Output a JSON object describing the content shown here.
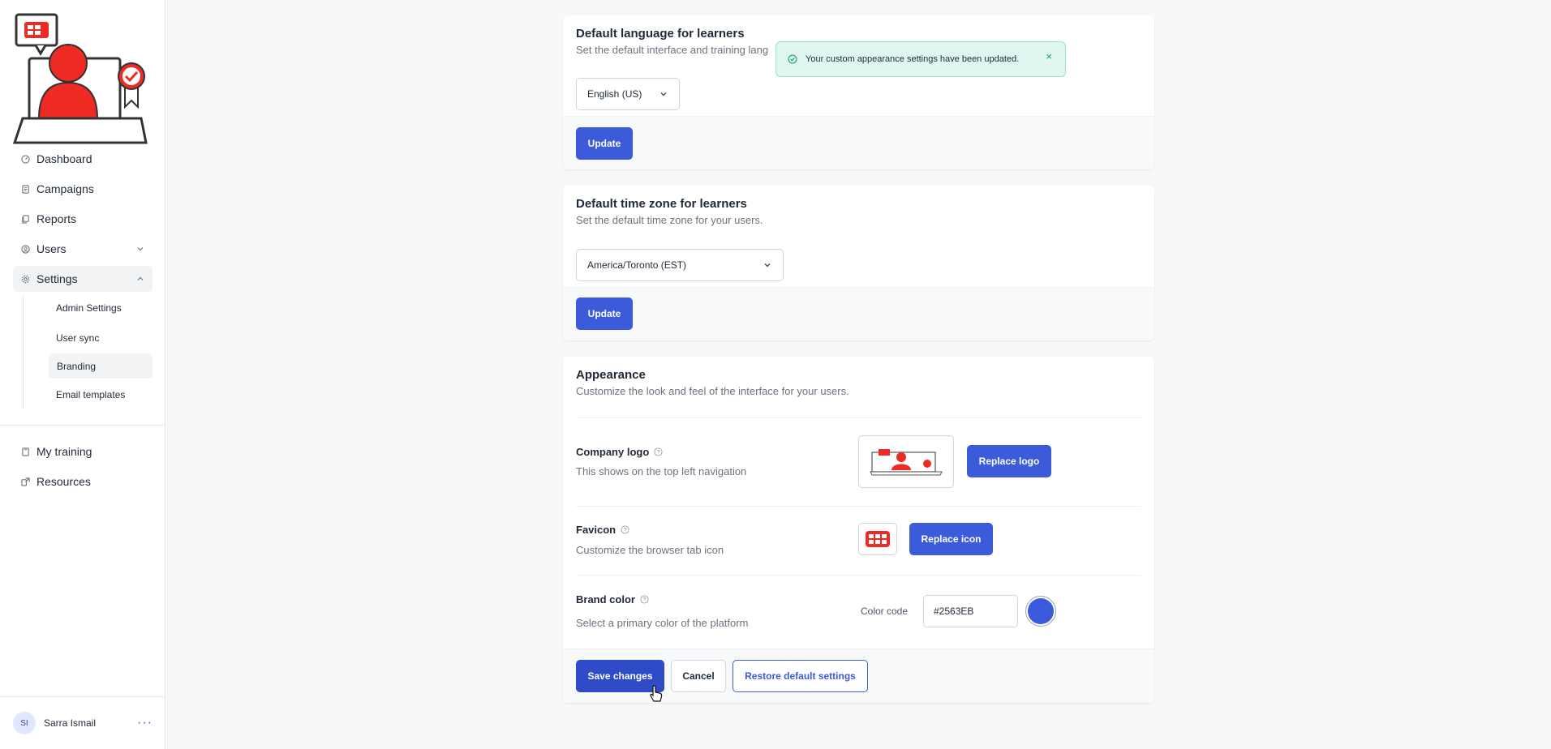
{
  "sidebar": {
    "nav": [
      {
        "label": "Dashboard",
        "icon": "gauge-icon"
      },
      {
        "label": "Campaigns",
        "icon": "document-icon"
      },
      {
        "label": "Reports",
        "icon": "copy-icon"
      },
      {
        "label": "Users",
        "icon": "user-circle-icon"
      },
      {
        "label": "Settings",
        "icon": "gear-icon"
      }
    ],
    "settings_sub": [
      "Admin Settings",
      "User sync",
      "Branding",
      "Email templates"
    ],
    "bottom_nav": [
      {
        "label": "My training",
        "icon": "book-icon"
      },
      {
        "label": "Resources",
        "icon": "link-icon"
      }
    ],
    "user": {
      "initials": "SI",
      "name": "Sarra Ismail",
      "menu": "···"
    }
  },
  "toast": {
    "message": "Your custom appearance settings have been updated.",
    "close": "×"
  },
  "language_card": {
    "title": "Default language for learners",
    "description": "Set the default interface and training lang",
    "selected": "English (US)",
    "button": "Update"
  },
  "timezone_card": {
    "title": "Default time zone for learners",
    "description": "Set the default time zone for your users.",
    "selected": "America/Toronto (EST)",
    "button": "Update"
  },
  "appearance_card": {
    "title": "Appearance",
    "description": "Customize the look and feel of the interface for your users.",
    "logo": {
      "label": "Company logo",
      "description": "This shows on the top left navigation",
      "button": "Replace logo"
    },
    "favicon": {
      "label": "Favicon",
      "description": "Customize the browser tab icon",
      "button": "Replace icon"
    },
    "brand": {
      "label": "Brand color",
      "description": "Select a primary color of the platform",
      "color_label": "Color code",
      "value": "#2563EB"
    },
    "actions": {
      "save": "Save changes",
      "cancel": "Cancel",
      "restore": "Restore default settings"
    }
  },
  "colors": {
    "accent": "#3b5bdb",
    "brand_red": "#ee2a24",
    "toast_bg": "#e0f7f1"
  }
}
